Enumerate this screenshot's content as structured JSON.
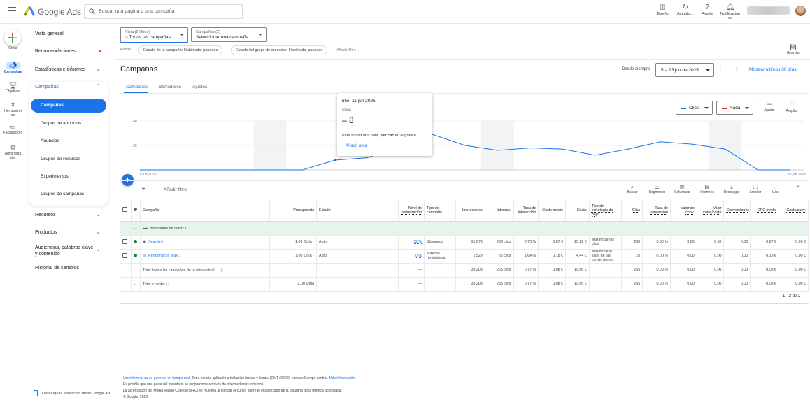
{
  "app": {
    "brand": "Google Ads",
    "search_placeholder": "Buscar una página o una campaña",
    "topbar": [
      {
        "label": "Diseño",
        "icon": "layout-icon"
      },
      {
        "label": "Actualiz...",
        "icon": "refresh-icon"
      },
      {
        "label": "Ayuda",
        "icon": "help-icon"
      },
      {
        "label": "Notificacion es",
        "icon": "bell-icon"
      }
    ]
  },
  "rail": {
    "create": "Crear",
    "items": [
      {
        "label": "Campañas",
        "icon": "megaphone-icon"
      },
      {
        "label": "Objetivos",
        "icon": "trophy-icon"
      },
      {
        "label": "Herramient as",
        "icon": "tools-icon"
      },
      {
        "label": "Facturació n",
        "icon": "billing-icon"
      },
      {
        "label": "Administra dor",
        "icon": "admin-gear-icon"
      }
    ]
  },
  "nav": {
    "vista_general": "Vista general",
    "recomendaciones": "Recomendaciones",
    "estadisticas": "Estadísticas e informes",
    "campanas": "Campañas",
    "sub": [
      "Campañas",
      "Grupos de anuncios",
      "Anuncios",
      "Grupos de recursos",
      "Experimentos",
      "Grupos de campañas"
    ],
    "recursos": "Recursos",
    "productos": "Productos",
    "audiencias": "Audiencias, palabras clave y contenido",
    "historial": "Historial de cambios",
    "app_link": "Descarga la aplicación móvil Google Ad"
  },
  "filters": {
    "view_label": "Vista (2 filtros)",
    "view_value": "Todas las campañas",
    "camp_label": "Campañas (2)",
    "camp_value": "Seleccionar una campaña",
    "filtros": "Filtros",
    "chip1": "Estado de la campaña: Habilitado, pausado",
    "chip2": "Estado del grupo de anuncios: Habilitado, pausado",
    "add": "Añadir filtro",
    "save": "Guardar"
  },
  "header": {
    "title": "Campañas",
    "since": "Desde siempre",
    "range": "5 – 25 jun de 2025",
    "last30": "Mostrar últimos 30 días",
    "tabs": [
      "Campañas",
      "Borradores",
      "Ajustes"
    ]
  },
  "chart_controls": {
    "metric1": "Clics",
    "metric2": "Nada",
    "metric1_color": "#1a73e8",
    "metric2_color": "#d93025",
    "ajustar": "Ajustar",
    "ampliar": "Ampliar"
  },
  "chart_data": {
    "type": "line",
    "x_start_label": "5 jun 2025",
    "x_end_label": "25 jun 2025",
    "y_ticks": [
      "40",
      "20",
      "0"
    ],
    "ylim": [
      0,
      40
    ],
    "x": [
      "5 jun",
      "6 jun",
      "7 jun",
      "8 jun",
      "9 jun",
      "10 jun",
      "11 jun",
      "12 jun",
      "13 jun",
      "14 jun",
      "15 jun",
      "16 jun",
      "17 jun",
      "18 jun",
      "19 jun",
      "20 jun",
      "21 jun",
      "22 jun",
      "23 jun",
      "24 jun",
      "25 jun"
    ],
    "values": [
      0,
      0,
      0,
      0,
      0,
      0,
      8,
      10,
      20,
      29,
      20,
      16,
      18,
      17,
      12,
      17,
      23,
      21,
      17,
      0,
      0
    ],
    "color": "#1a73e8"
  },
  "tooltip": {
    "date": "mié, 11 jun 2025",
    "metric": "Clics",
    "value": "8",
    "note_prefix": "Para añadir una nota, ",
    "note_bold": "haz clic",
    "note_suffix": " en el gráfico",
    "add_note": "Añadir nota"
  },
  "table_tools": {
    "add_filter": "Añadir filtro",
    "tools": [
      {
        "label": "Buscar",
        "icon": "search-icon"
      },
      {
        "label": "Segmento",
        "icon": "segment-icon"
      },
      {
        "label": "Columnas",
        "icon": "columns-icon"
      },
      {
        "label": "Informes",
        "icon": "reports-icon"
      },
      {
        "label": "Descargar",
        "icon": "download-icon"
      },
      {
        "label": "Ampliar",
        "icon": "expand-icon"
      },
      {
        "label": "Más",
        "icon": "more-icon"
      }
    ]
  },
  "table": {
    "headers": [
      "Campaña",
      "Presupuesto",
      "Estado",
      "Nivel de optimización",
      "Tipo de campaña",
      "Impresiones",
      "Interacc.",
      "Tasa de interacción",
      "Coste medio",
      "Coste",
      "Tipo de estrategia de puja",
      "Clics",
      "Tasa de conversión",
      "Valor de conv.",
      "Valor conv./coste",
      "Conversiones",
      "CPC medio",
      "Coste/conv."
    ],
    "draft": "Borradores en curso: 0",
    "rows": [
      {
        "name": "Search-1",
        "budget": "1,00 €/día",
        "status": "Apto",
        "opt": "79 %",
        "type": "Búsqueda",
        "impr": "31.679",
        "inter": "230 clics",
        "rate": "0,73 %",
        "avg": "0,07 €",
        "cost": "15,22 €",
        "strategy": "Maximizar los clics",
        "clicks": "230",
        "convrate": "0,00 %",
        "convval": "0,00",
        "valcost": "0,00",
        "conv": "0,00",
        "cpc": "0,07 €",
        "costconv": "0,00 €"
      },
      {
        "name": "Performance Max-1",
        "budget": "1,00 €/día",
        "status": "Apto",
        "opt": "0 %",
        "type": "Máximo rendimiento",
        "impr": "1.529",
        "inter": "25 clics",
        "rate": "1,64 %",
        "avg": "0,18 €",
        "cost": "4,44 €",
        "strategy": "Maximizar el valor de las conversiones",
        "clicks": "25",
        "convrate": "0,00 %",
        "convval": "0,00",
        "valcost": "0,00",
        "conv": "0,00",
        "cpc": "0,18 €",
        "costconv": "0,00 €"
      }
    ],
    "total1": {
      "label": "Total: todas las campañas de tu vista actual ...",
      "opt": "—",
      "impr": "33.208",
      "inter": "255 clics",
      "rate": "0,77 %",
      "avg": "0,08 €",
      "cost": "19,66 €",
      "clicks": "255",
      "convrate": "0,00 %",
      "convval": "0,00",
      "valcost": "0,00",
      "conv": "0,00",
      "cpc": "0,08 €",
      "costconv": "0,00 €"
    },
    "total2": {
      "label": "Total: cuenta",
      "budget": "2,00 €/día",
      "opt": "—",
      "impr": "33.208",
      "inter": "255 clics",
      "rate": "0,77 %",
      "avg": "0,08 €",
      "cost": "19,66 €",
      "clicks": "255",
      "convrate": "0,00 %",
      "convval": "0,00",
      "valcost": "0,00",
      "conv": "0,00",
      "cpc": "0,08 €",
      "costconv": "0,00 €"
    },
    "pager": "1 - 2 de 2"
  },
  "footer": {
    "line1_link": "Los informes no se generan en tiempo real.",
    "line1_rest": " Zona horaria aplicable a todas las fechas y horas: (GMT+02:00) hora de Europa central. ",
    "line1_more": "Más información",
    "line2": "Es posible que una parte del inventario se proporcione a través de intermediarios externos.",
    "line3": "La acreditación del Media Rating Council (MRC) se muestra al colocar el cursor sobre el encabezado de la columna de la métrica acreditada.",
    "line4": "© Google, 2025."
  }
}
